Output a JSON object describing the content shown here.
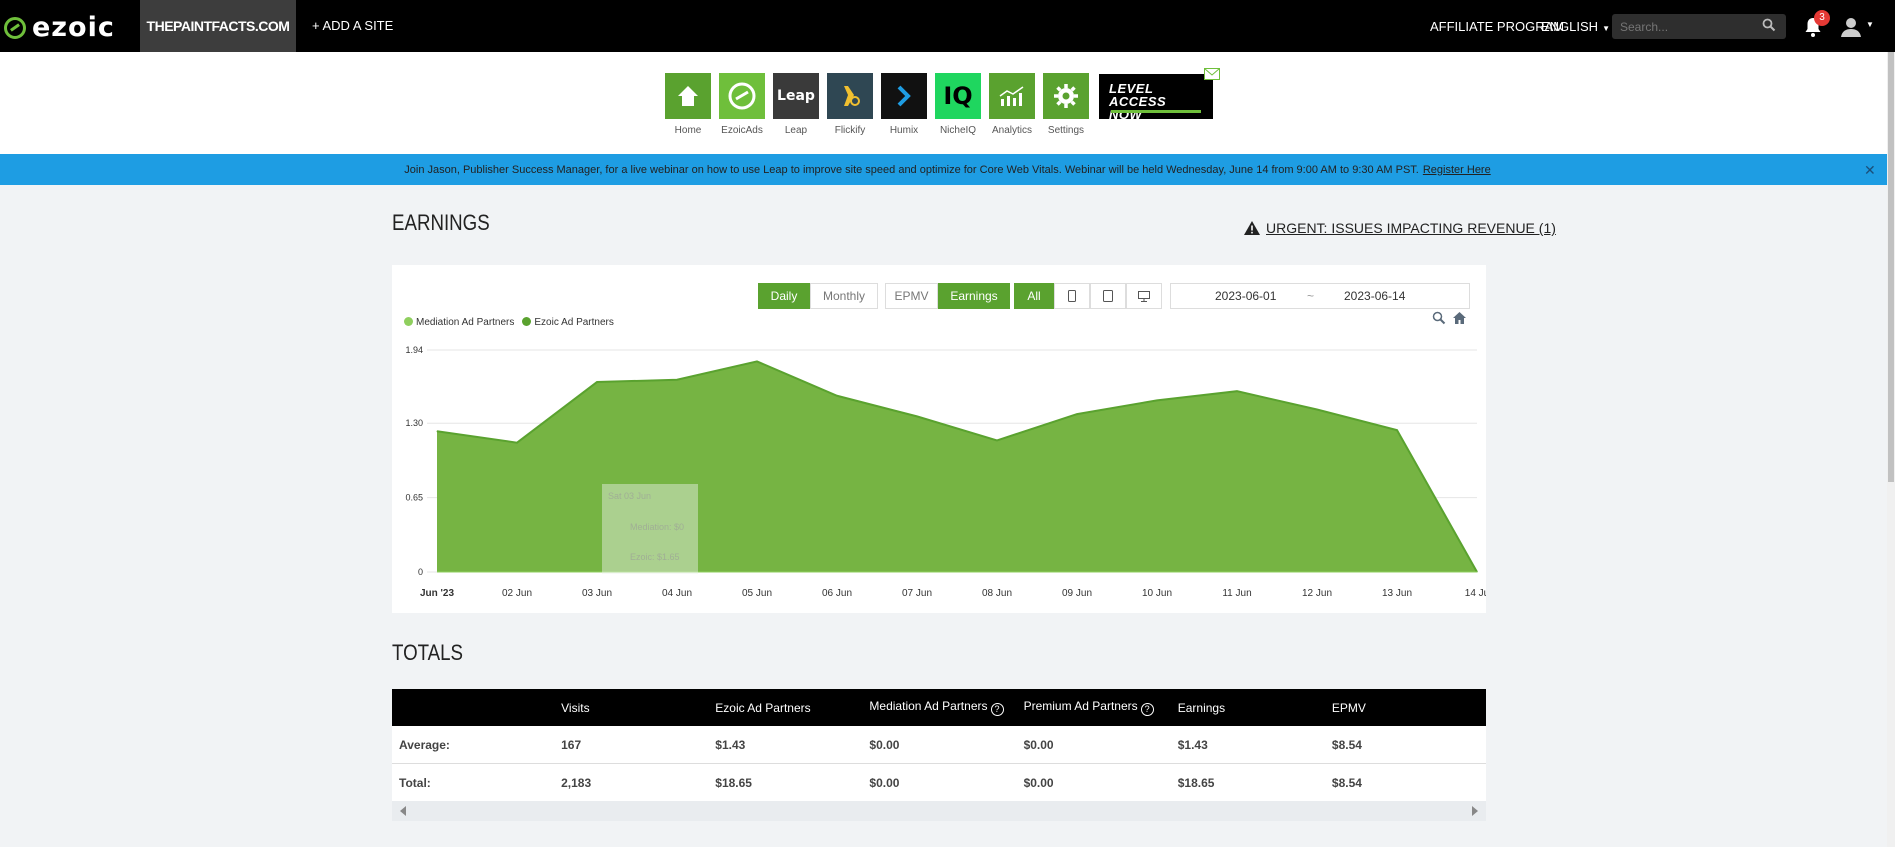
{
  "header": {
    "logo_text": "ezoic",
    "site_name": "THEPAINTFACTS.COM",
    "add_site": "+ ADD A SITE",
    "affiliate": "AFFILIATE PROGRAM",
    "language": "ENGLISH",
    "search_placeholder": "Search...",
    "notification_count": "3"
  },
  "apps": [
    {
      "label": "Home",
      "color": "#5aa22f",
      "icon": "home-icon"
    },
    {
      "label": "EzoicAds",
      "color": "#6fbf3b",
      "icon": "ezoic-ads-icon"
    },
    {
      "label": "Leap",
      "color": "#3a3a3a",
      "icon": "leap-icon",
      "text": "Leap"
    },
    {
      "label": "Flickify",
      "color": "#2f4753",
      "icon": "flickify-icon"
    },
    {
      "label": "Humix",
      "color": "#111111",
      "icon": "humix-icon"
    },
    {
      "label": "NicheIQ",
      "color": "#1fd65f",
      "icon": "nicheiq-icon",
      "text": "IQ"
    },
    {
      "label": "Analytics",
      "color": "#5aa22f",
      "icon": "analytics-icon"
    },
    {
      "label": "Settings",
      "color": "#5aa22f",
      "icon": "settings-icon"
    }
  ],
  "level_button": {
    "line1": "LEVEL",
    "line2": "ACCESS NOW"
  },
  "banner": {
    "text": "Join Jason, Publisher Success Manager, for a live webinar on how to use Leap to improve site speed and optimize for Core Web Vitals. Webinar will be held Wednesday, June 14 from 9:00 AM to 9:30 AM PST.",
    "link": "Register Here",
    "close": "✕"
  },
  "earnings": {
    "title": "EARNINGS",
    "urgent": "URGENT: ISSUES IMPACTING REVENUE (1)",
    "period_buttons": [
      "Daily",
      "Monthly"
    ],
    "metric_buttons": [
      "EPMV",
      "Earnings"
    ],
    "device_all": "All",
    "date_from": "2023-06-01",
    "date_sep": "~",
    "date_to": "2023-06-14"
  },
  "chart_data": {
    "type": "area",
    "x": [
      "Jun '23",
      "02 Jun",
      "03 Jun",
      "04 Jun",
      "05 Jun",
      "06 Jun",
      "07 Jun",
      "08 Jun",
      "09 Jun",
      "10 Jun",
      "11 Jun",
      "12 Jun",
      "13 Jun",
      "14 Ju"
    ],
    "series": [
      {
        "name": "Mediation Ad Partners",
        "color": "#8fcf5e",
        "values": [
          0,
          0,
          0,
          0,
          0,
          0,
          0,
          0,
          0,
          0,
          0,
          0,
          0,
          0
        ]
      },
      {
        "name": "Ezoic Ad Partners",
        "color": "#5aa22f",
        "values": [
          1.23,
          1.13,
          1.66,
          1.68,
          1.84,
          1.54,
          1.36,
          1.15,
          1.38,
          1.5,
          1.58,
          1.42,
          1.24,
          0
        ]
      }
    ],
    "yticks": [
      "0",
      "0.65",
      "1.30",
      "1.94"
    ],
    "ylim": [
      0,
      1.94
    ],
    "grid": true,
    "legend_position": "top-left",
    "tooltip": {
      "title": "Sat 03 Jun",
      "line1": "Mediation: $0",
      "line2": "Ezoic: $1.65"
    }
  },
  "totals": {
    "title": "TOTALS",
    "columns": [
      "",
      "Visits",
      "Ezoic Ad Partners",
      "Mediation Ad Partners",
      "Premium Ad Partners",
      "Earnings",
      "EPMV"
    ],
    "rows": [
      [
        "Average:",
        "167",
        "$1.43",
        "$0.00",
        "$0.00",
        "$1.43",
        "$8.54"
      ],
      [
        "Total:",
        "2,183",
        "$18.65",
        "$0.00",
        "$0.00",
        "$18.65",
        "$8.54"
      ]
    ]
  }
}
